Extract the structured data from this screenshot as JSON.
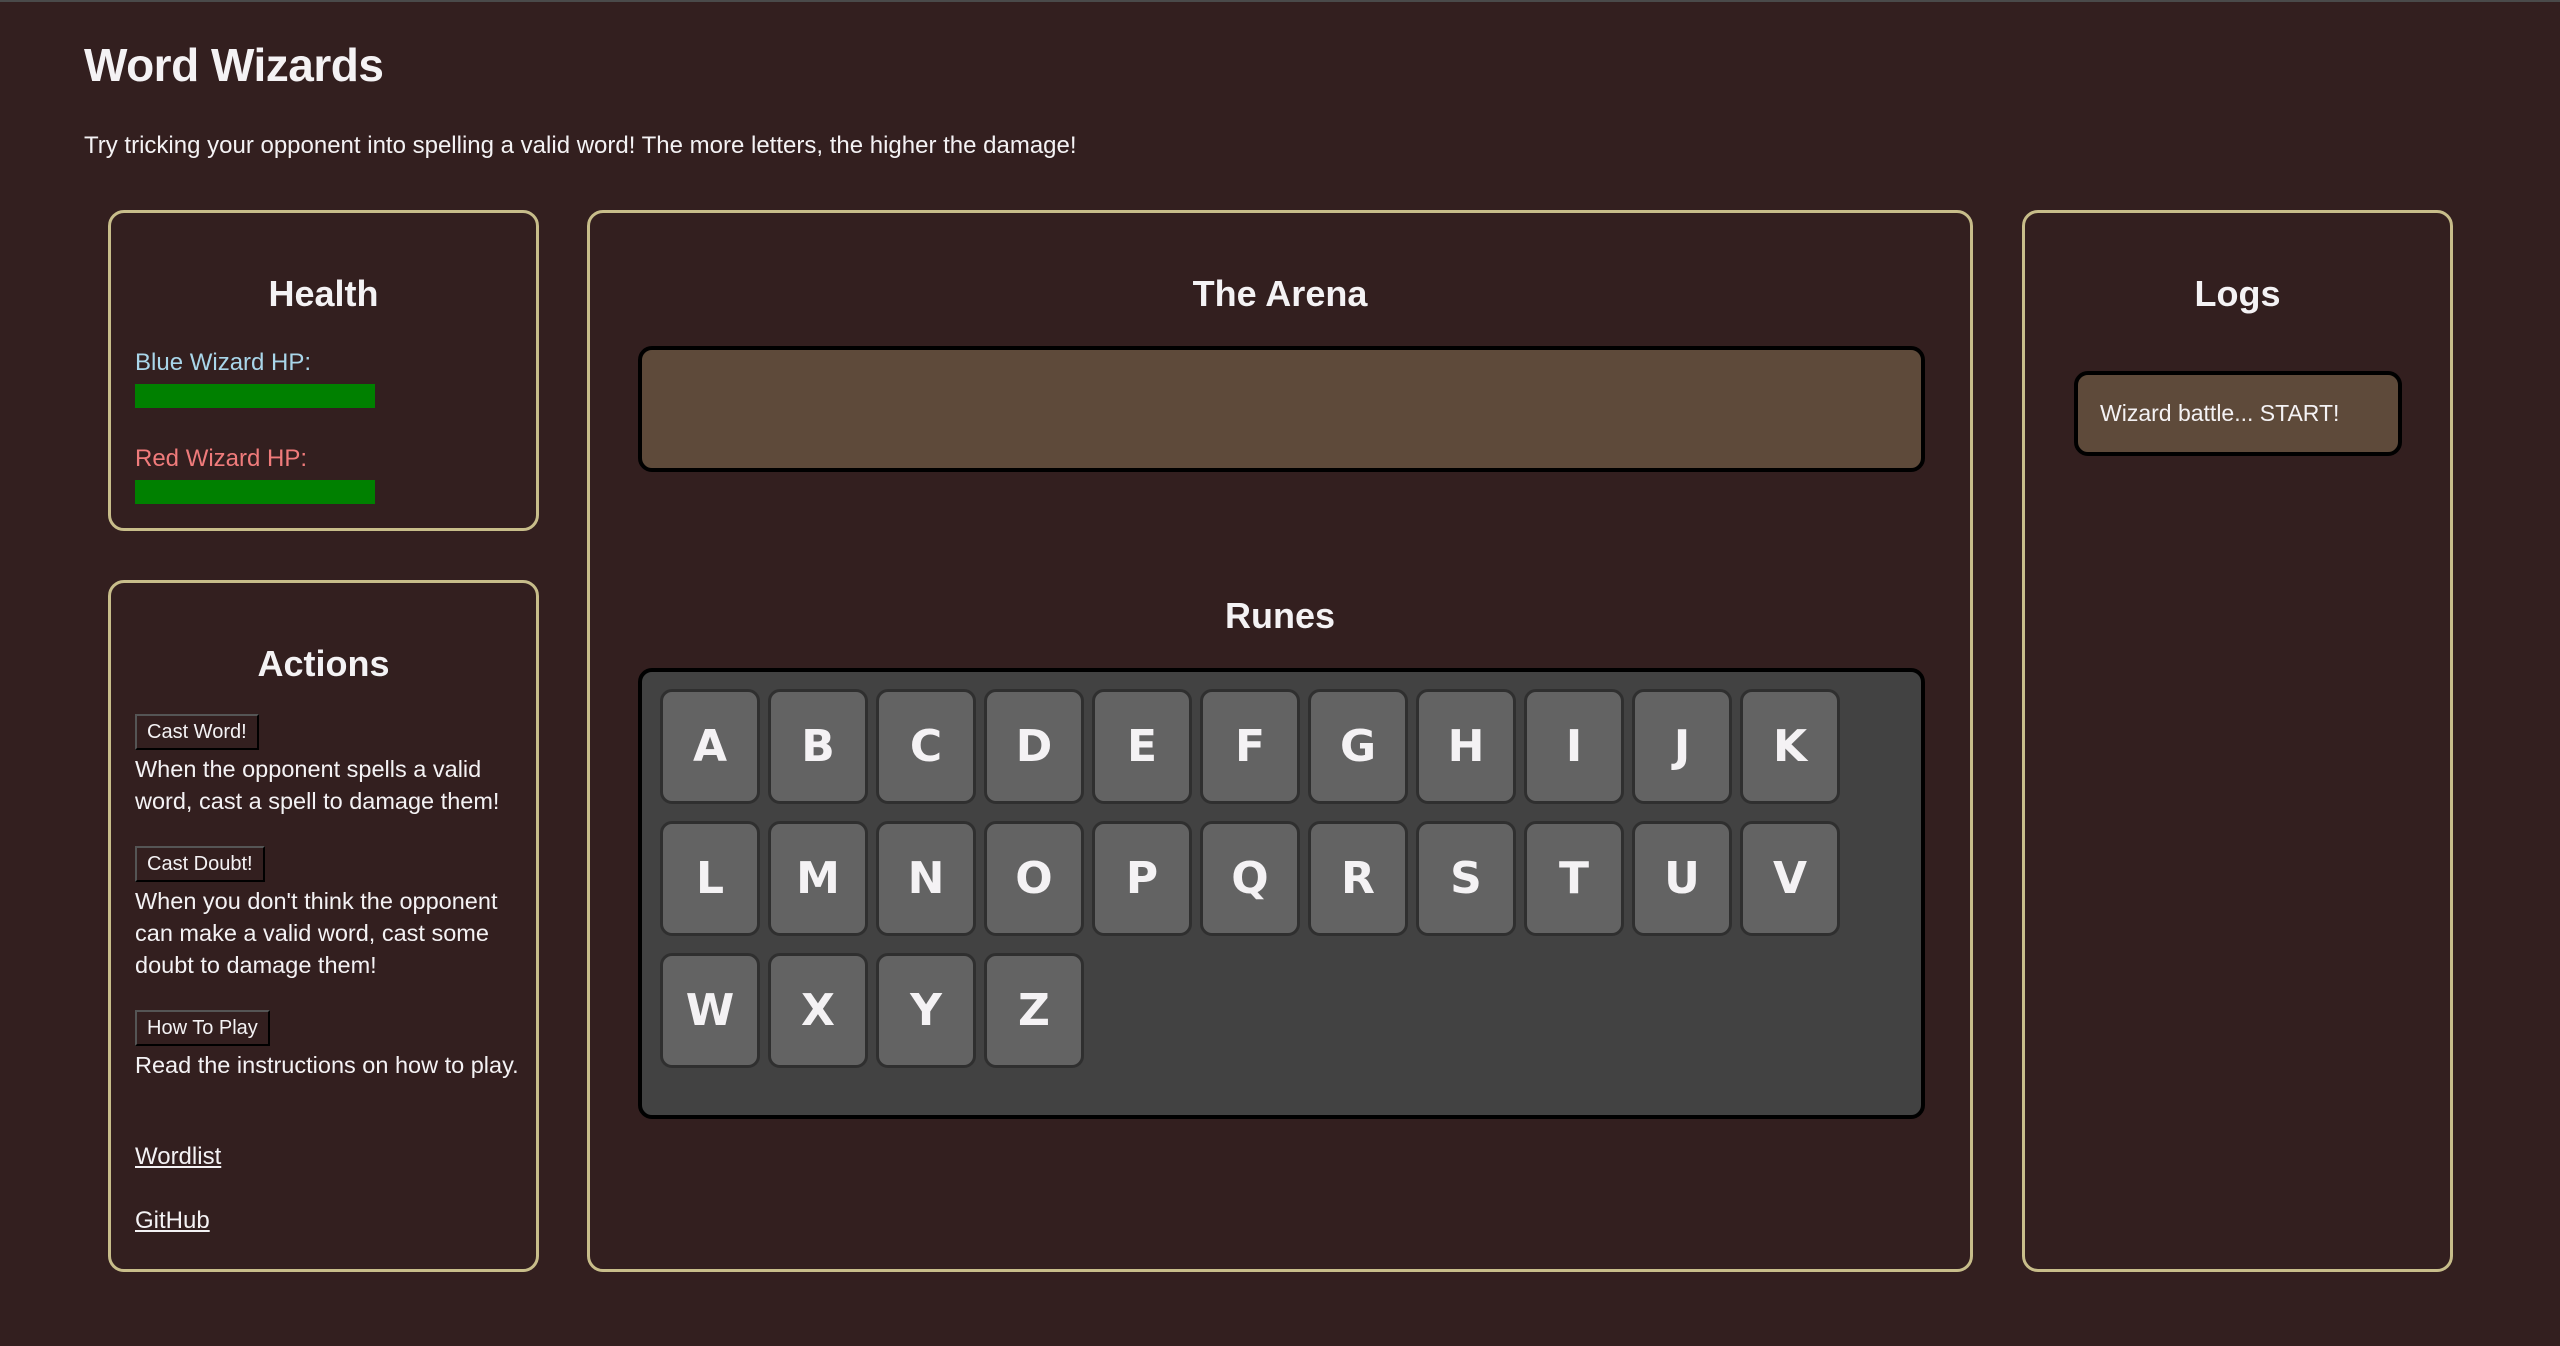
{
  "header": {
    "title": "Word Wizards",
    "subtitle": "Try tricking your opponent into spelling a valid word! The more letters, the higher the damage!"
  },
  "health": {
    "heading": "Health",
    "blue": {
      "label": "Blue Wizard HP:",
      "hp_percent": 100,
      "bar_color": "#008000",
      "label_color": "#a9d6ea"
    },
    "red": {
      "label": "Red Wizard HP:",
      "hp_percent": 100,
      "bar_color": "#008000",
      "label_color": "#f07b7b"
    }
  },
  "actions": {
    "heading": "Actions",
    "items": [
      {
        "button": "Cast Word!",
        "description": "When the opponent spells a valid word, cast a spell to damage them!"
      },
      {
        "button": "Cast Doubt!",
        "description": "When you don't think the opponent can make a valid word, cast some doubt to damage them!"
      },
      {
        "button": "How To Play",
        "description": "Read the instructions on how to play."
      }
    ],
    "links": [
      "Wordlist",
      "GitHub"
    ]
  },
  "arena": {
    "heading": "The Arena",
    "current_word": ""
  },
  "runes": {
    "heading": "Runes",
    "rows": [
      [
        "A",
        "B",
        "C",
        "D",
        "E",
        "F",
        "G",
        "H",
        "I",
        "J",
        "K"
      ],
      [
        "L",
        "M",
        "N",
        "O",
        "P",
        "Q",
        "R",
        "S",
        "T",
        "U",
        "V"
      ],
      [
        "W",
        "X",
        "Y",
        "Z"
      ]
    ]
  },
  "logs": {
    "heading": "Logs",
    "entries": [
      "Wizard battle... START!"
    ]
  },
  "colors": {
    "background": "#331f1f",
    "panel_border": "#c8bd8a",
    "arena_fill": "#5e4a3a",
    "keyboard_fill": "#424242",
    "key_fill": "#636363"
  }
}
